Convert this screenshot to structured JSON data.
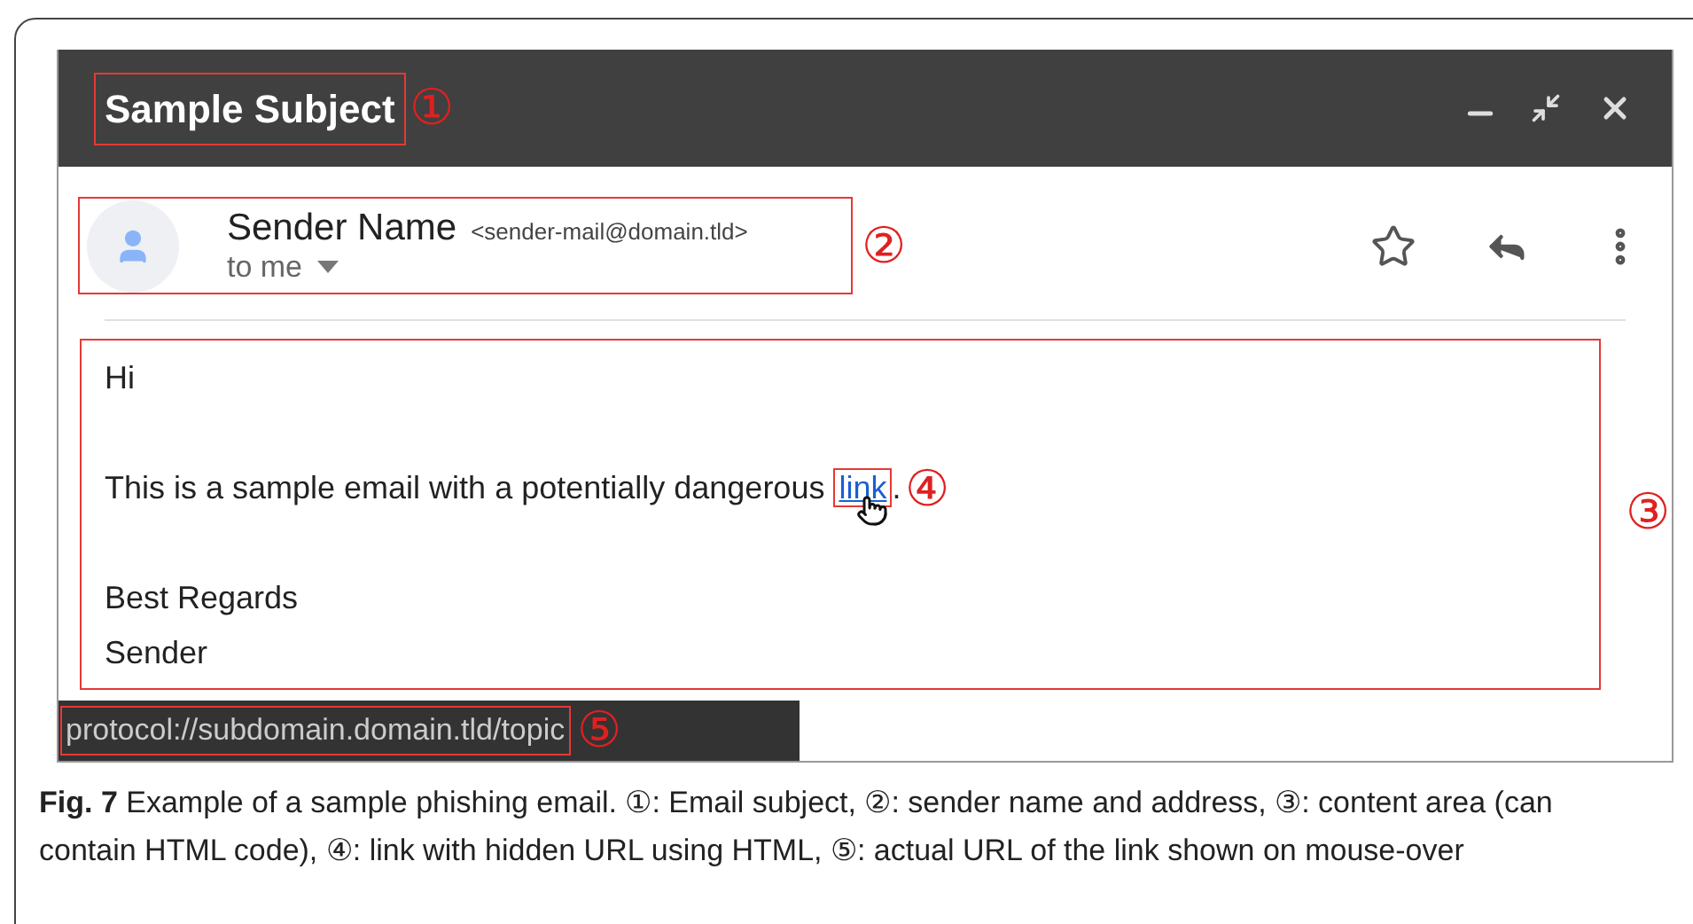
{
  "window": {
    "title": "Sample Subject",
    "title_marker": "①"
  },
  "sender": {
    "name": "Sender Name",
    "address": "<sender-mail@domain.tld>",
    "recipient": "to me",
    "marker": "②"
  },
  "body": {
    "greeting": "Hi",
    "sentence": "This is a sample email with a potentially dangerous",
    "link": "link",
    "sentence_end": ".",
    "link_marker": "④",
    "closing": [
      "Best Regards",
      "Sender"
    ],
    "marker": "③"
  },
  "status_bar": {
    "url": "protocol://subdomain.domain.tld/topic",
    "marker": "⑤"
  },
  "caption": "**Fig. 7** Example of a sample phishing email. ①: Email subject, ②: sender name and address, ③: content area (can contain HTML code), ④: link with hidden URL using HTML, ⑤: actual URL of the link shown on mouse-over"
}
